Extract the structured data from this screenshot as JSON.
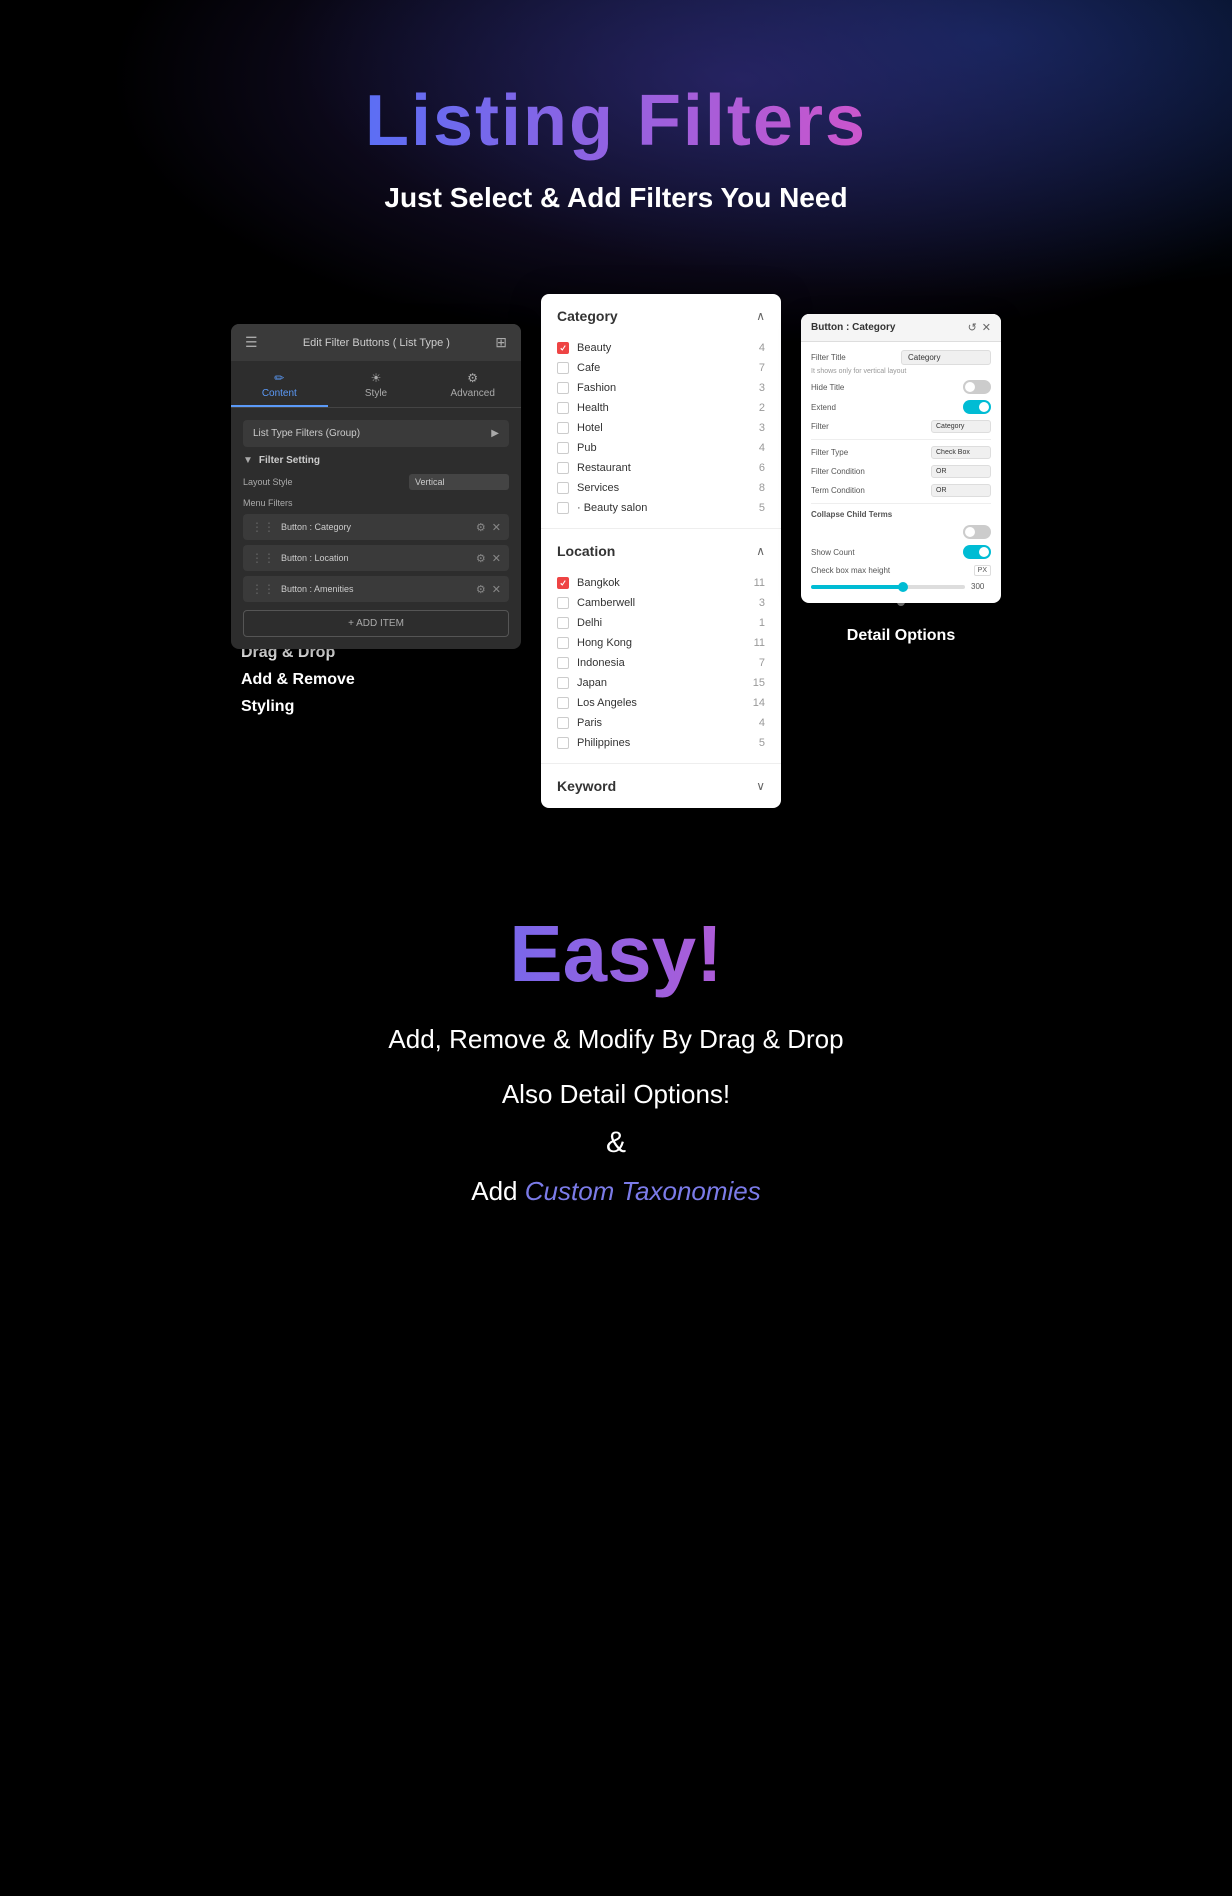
{
  "page": {
    "background": "#000",
    "title": "Listing Filters",
    "subtitle": "Just Select & Add Filters You Need"
  },
  "title": {
    "main": "Listing Filters",
    "sub": "Just Select & Add Filters You Need"
  },
  "left_panel": {
    "header": "Edit Filter Buttons ( List Type )",
    "tabs": [
      {
        "label": "Content",
        "icon": "✏️"
      },
      {
        "label": "Style",
        "icon": "☀"
      },
      {
        "label": "Advanced",
        "icon": "⚙"
      }
    ],
    "list_type_label": "List Type Filters (Group)",
    "filter_setting_label": "Filter Setting",
    "layout_style_label": "Layout Style",
    "layout_style_value": "Vertical",
    "menu_filters_label": "Menu Filters",
    "filter_items": [
      {
        "label": "Button : Category"
      },
      {
        "label": "Button : Location"
      },
      {
        "label": "Button : Amenities"
      }
    ],
    "add_item_label": "+ ADD ITEM"
  },
  "left_panel_footer": {
    "line1": "Drag & Drop",
    "line2": "Add & Remove",
    "line3": "Styling"
  },
  "center_panel": {
    "category_title": "Category",
    "category_items": [
      {
        "label": "Beauty",
        "count": "4",
        "checked": true
      },
      {
        "label": "Cafe",
        "count": "7",
        "checked": false
      },
      {
        "label": "Fashion",
        "count": "3",
        "checked": false
      },
      {
        "label": "Health",
        "count": "2",
        "checked": false
      },
      {
        "label": "Hotel",
        "count": "3",
        "checked": false
      },
      {
        "label": "Pub",
        "count": "4",
        "checked": false
      },
      {
        "label": "Restaurant",
        "count": "6",
        "checked": false
      },
      {
        "label": "Services",
        "count": "8",
        "checked": false
      },
      {
        "label": "· Beauty salon",
        "count": "5",
        "checked": false
      }
    ],
    "location_title": "Location",
    "location_items": [
      {
        "label": "Bangkok",
        "count": "11",
        "checked": true
      },
      {
        "label": "Camberwell",
        "count": "3",
        "checked": false
      },
      {
        "label": "Delhi",
        "count": "1",
        "checked": false
      },
      {
        "label": "Hong Kong",
        "count": "11",
        "checked": false
      },
      {
        "label": "Indonesia",
        "count": "7",
        "checked": false
      },
      {
        "label": "Japan",
        "count": "15",
        "checked": false
      },
      {
        "label": "Los Angeles",
        "count": "14",
        "checked": false
      },
      {
        "label": "Paris",
        "count": "4",
        "checked": false
      },
      {
        "label": "Philippines",
        "count": "5",
        "checked": false
      }
    ],
    "keyword_title": "Keyword"
  },
  "right_panel": {
    "title": "Button : Category",
    "filter_title_label": "Filter Title",
    "filter_title_value": "Category",
    "hint": "It shows only for vertical layout",
    "hide_title_label": "Hide Title",
    "hide_title_on": false,
    "extend_label": "Extend",
    "extend_on": true,
    "filter_label": "Filter",
    "filter_value": "Category",
    "filter_type_label": "Filter Type",
    "filter_type_value": "Check Box",
    "filter_condition_label": "Filter Condition",
    "filter_condition_value": "OR",
    "term_condition_label": "Term Condition",
    "term_condition_value": "OR",
    "collapse_child_terms_label": "Collapse Child Terms",
    "collapse_child_on": false,
    "show_count_label": "Show Count",
    "show_count_on": true,
    "checkbox_max_height_label": "Check box max height",
    "checkbox_max_height_value": "300",
    "unit": "PX"
  },
  "right_panel_footer": {
    "label": "Detail Options"
  },
  "bottom": {
    "easy_title": "Easy!",
    "line1": "Add, Remove & Modify By Drag & Drop",
    "line2": "Also Detail Options!",
    "and_text": "&",
    "line3_prefix": "Add  ",
    "line3_link": "Custom Taxonomies"
  }
}
